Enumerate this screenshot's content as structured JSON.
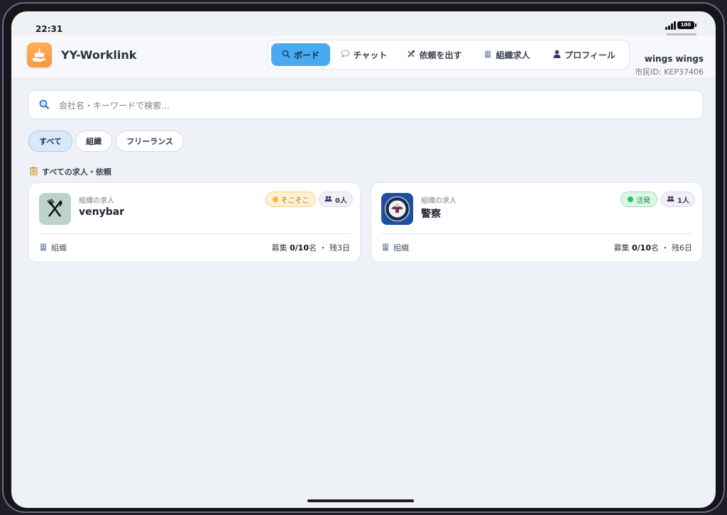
{
  "status": {
    "time": "22:31",
    "battery": "100"
  },
  "app": {
    "title": "YY-Worklink"
  },
  "nav": {
    "items": [
      {
        "label": "ボード",
        "icon": "search-icon",
        "active": true
      },
      {
        "label": "チャット",
        "icon": "speech-bubble-icon"
      },
      {
        "label": "依頼を出す",
        "icon": "tools-icon"
      },
      {
        "label": "組織求人",
        "icon": "building-icon"
      },
      {
        "label": "プロフィール",
        "icon": "person-icon"
      }
    ]
  },
  "user": {
    "name": "wings wings",
    "citizen_id": "市民ID: KEP37406"
  },
  "search": {
    "placeholder": "会社名・キーワードで検索…"
  },
  "filters": [
    {
      "label": "すべて",
      "active": true
    },
    {
      "label": "組織"
    },
    {
      "label": "フリーランス"
    }
  ],
  "section": {
    "title": "すべての求人・依頼",
    "icon": "clipboard-icon"
  },
  "cards": [
    {
      "kind": "組織の求人",
      "name": "venybar",
      "thumb_icon": "fork-knife-icon",
      "status_label": "そこそこ",
      "status_color": "#f5b93a",
      "member_count": "0人",
      "type_label": "組織",
      "recruit_prefix": "募集 ",
      "recruit_value": "0/10",
      "recruit_suffix": "名",
      "separator": "・",
      "remaining": "残3日"
    },
    {
      "kind": "組織の求人",
      "name": "警察",
      "thumb_icon": "seal-icon",
      "status_label": "活発",
      "status_color": "#22c55e",
      "member_count": "1人",
      "type_label": "組織",
      "recruit_prefix": "募集 ",
      "recruit_value": "0/10",
      "recruit_suffix": "名",
      "separator": "・",
      "remaining": "残6日"
    }
  ],
  "colors": {
    "accent": "#4aaaf0",
    "background": "#eef1f6"
  }
}
